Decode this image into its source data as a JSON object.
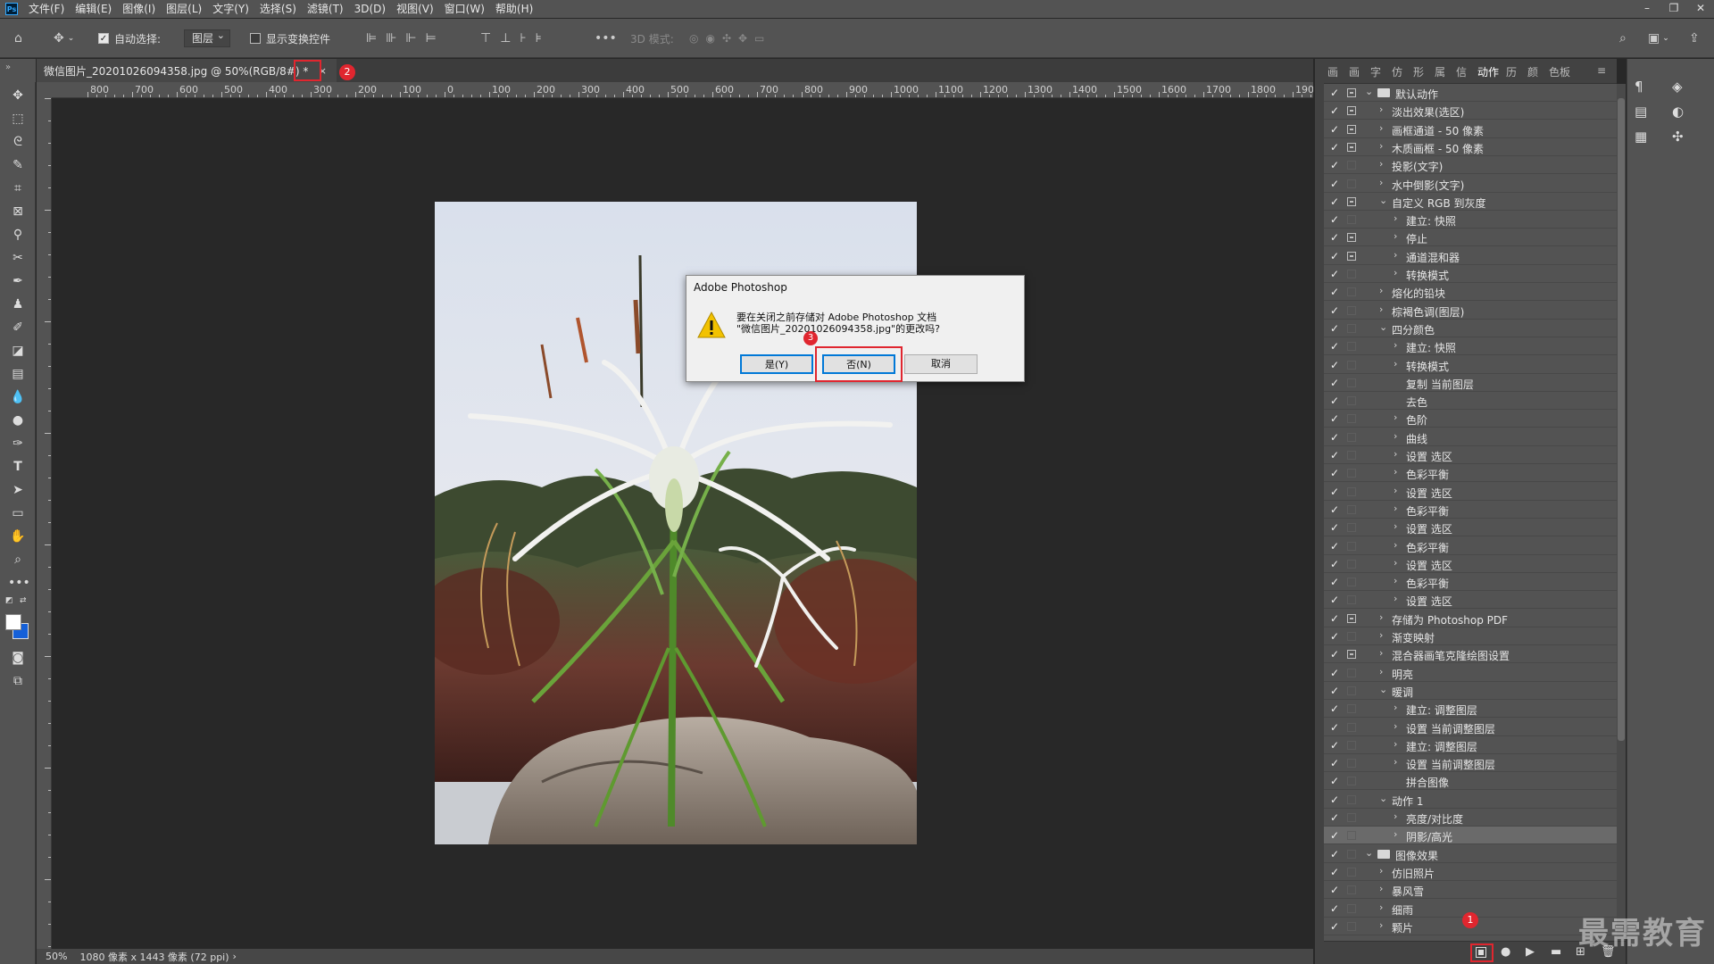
{
  "menu": [
    "文件(F)",
    "编辑(E)",
    "图像(I)",
    "图层(L)",
    "文字(Y)",
    "选择(S)",
    "滤镜(T)",
    "3D(D)",
    "视图(V)",
    "窗口(W)",
    "帮助(H)"
  ],
  "options": {
    "auto_select_label": "自动选择:",
    "auto_select_value": "图层",
    "show_transform_label": "显示变换控件",
    "mode_3d_label": "3D 模式:"
  },
  "document": {
    "tab_title": "微信图片_20201026094358.jpg @ 50%(RGB/8#) *",
    "close_glyph": "×"
  },
  "badges": [
    "1",
    "2",
    "3"
  ],
  "ruler": [
    "800",
    "700",
    "600",
    "500",
    "400",
    "300",
    "200",
    "100",
    "0",
    "100",
    "200",
    "300",
    "400",
    "500",
    "600",
    "700",
    "800",
    "900",
    "1000",
    "1100",
    "1200",
    "1300",
    "1400",
    "1500",
    "1600",
    "1700",
    "1800",
    "190"
  ],
  "status": {
    "zoom": "50%",
    "info": "1080 像素 x 1443 像素 (72 ppi)"
  },
  "dialog": {
    "title": "Adobe Photoshop",
    "line1": "要在关闭之前存储对 Adobe Photoshop 文档",
    "line2": "\"微信图片_20201026094358.jpg\"的更改吗?",
    "yes": "是(Y)",
    "no": "否(N)",
    "cancel": "取消"
  },
  "panel_tabs": [
    "画",
    "画",
    "字",
    "仿",
    "形",
    "属",
    "信",
    "动作",
    "历",
    "颜",
    "色板"
  ],
  "actions": [
    {
      "label": "默认动作",
      "level": 0,
      "type": "set",
      "open": true,
      "dlg": true
    },
    {
      "label": "淡出效果(选区)",
      "level": 1,
      "dlg": true
    },
    {
      "label": "画框通道 - 50 像素",
      "level": 1,
      "dlg": true
    },
    {
      "label": "木质画框 - 50 像素",
      "level": 1,
      "dlg": true
    },
    {
      "label": "投影(文字)",
      "level": 1
    },
    {
      "label": "水中倒影(文字)",
      "level": 1
    },
    {
      "label": "自定义 RGB 到灰度",
      "level": 1,
      "open": true,
      "dlg": true
    },
    {
      "label": "建立: 快照",
      "level": 2
    },
    {
      "label": "停止",
      "level": 2,
      "dlg": true
    },
    {
      "label": "通道混和器",
      "level": 2,
      "dlg": true
    },
    {
      "label": "转换模式",
      "level": 2
    },
    {
      "label": "熔化的铅块",
      "level": 1
    },
    {
      "label": "棕褐色调(图层)",
      "level": 1
    },
    {
      "label": "四分颜色",
      "level": 1,
      "open": true
    },
    {
      "label": "建立: 快照",
      "level": 2
    },
    {
      "label": "转换模式",
      "level": 2
    },
    {
      "label": "复制 当前图层",
      "level": 2,
      "leaf": true
    },
    {
      "label": "去色",
      "level": 2,
      "leaf": true
    },
    {
      "label": "色阶",
      "level": 2
    },
    {
      "label": "曲线",
      "level": 2
    },
    {
      "label": "设置 选区",
      "level": 2
    },
    {
      "label": "色彩平衡",
      "level": 2
    },
    {
      "label": "设置 选区",
      "level": 2
    },
    {
      "label": "色彩平衡",
      "level": 2
    },
    {
      "label": "设置 选区",
      "level": 2
    },
    {
      "label": "色彩平衡",
      "level": 2
    },
    {
      "label": "设置 选区",
      "level": 2
    },
    {
      "label": "色彩平衡",
      "level": 2
    },
    {
      "label": "设置 选区",
      "level": 2
    },
    {
      "label": "存储为 Photoshop PDF",
      "level": 1,
      "dlg": true
    },
    {
      "label": "渐变映射",
      "level": 1
    },
    {
      "label": "混合器画笔克隆绘图设置",
      "level": 1,
      "dlg": true
    },
    {
      "label": "明亮",
      "level": 1
    },
    {
      "label": "暖调",
      "level": 1,
      "open": true
    },
    {
      "label": "建立: 调整图层",
      "level": 2
    },
    {
      "label": "设置 当前调整图层",
      "level": 2
    },
    {
      "label": "建立: 调整图层",
      "level": 2
    },
    {
      "label": "设置 当前调整图层",
      "level": 2
    },
    {
      "label": "拼合图像",
      "level": 2,
      "leaf": true
    },
    {
      "label": "动作 1",
      "level": 1,
      "open": true
    },
    {
      "label": "亮度/对比度",
      "level": 2
    },
    {
      "label": "阴影/高光",
      "level": 2,
      "highlight": true
    },
    {
      "label": "图像效果",
      "level": 0,
      "type": "set",
      "open": true
    },
    {
      "label": "仿旧照片",
      "level": 1
    },
    {
      "label": "暴风雪",
      "level": 1
    },
    {
      "label": "细雨",
      "level": 1
    },
    {
      "label": "颗片",
      "level": 1
    }
  ],
  "watermark": "最需教育",
  "colors": {
    "accent": "#0078d7",
    "highlight": "#e0262f"
  }
}
